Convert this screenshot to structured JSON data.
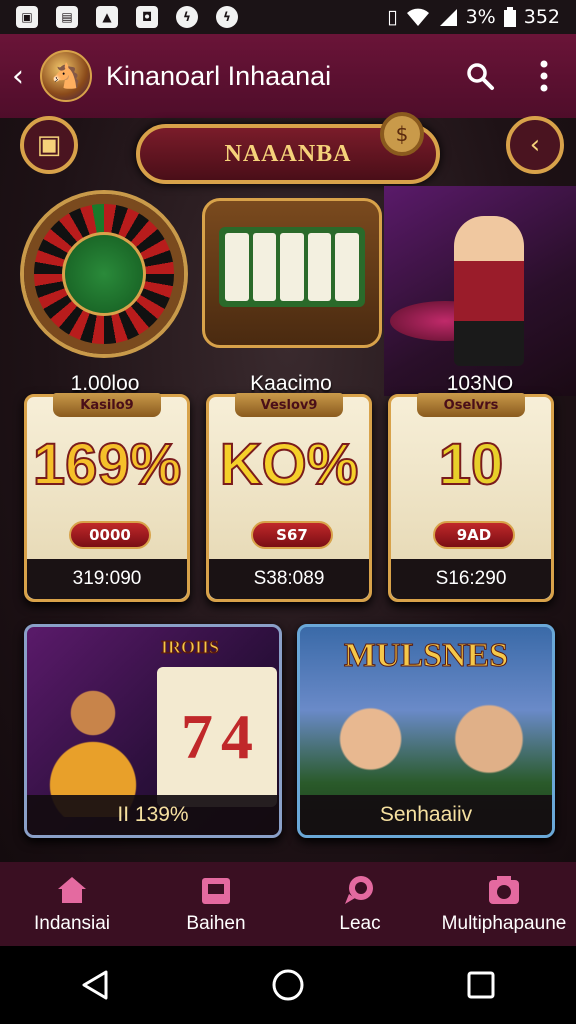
{
  "status_bar": {
    "battery": "3%",
    "time": "352",
    "icons": [
      "gallery-icon",
      "document-icon",
      "image-icon",
      "photo-icon",
      "messenger-icon",
      "messenger-icon",
      "vibrate-icon",
      "wifi-icon",
      "signal-icon",
      "battery-icon"
    ]
  },
  "app_bar": {
    "title": "Kinanoarl Inhaanai",
    "icons": [
      "back-arrow-icon",
      "app-logo",
      "search-icon",
      "more-vert-icon"
    ]
  },
  "banner": {
    "title": "NAAANBA",
    "icons": [
      "chest-icon",
      "money-bag-icon",
      "chevron-left-icon"
    ]
  },
  "top_games": [
    {
      "label": "1.00loo",
      "art": "roulette-wheel"
    },
    {
      "label": "Kaacimo",
      "art": "slot-machine"
    },
    {
      "label": "103NO",
      "art": "casino-dealer"
    }
  ],
  "slot_cards": [
    {
      "tab": "Kasilo9",
      "big": "169%",
      "pill": "0000",
      "amount": "319:090",
      "big_color": "#f5c02a"
    },
    {
      "tab": "Veslov9",
      "big": "KO%",
      "pill": "S67",
      "amount": "S38:089",
      "big_color": "#f5d02a"
    },
    {
      "tab": "Oselvrs",
      "big": "10",
      "pill": "9AD",
      "amount": "S16:290",
      "big_color": "#e8d02a"
    }
  ],
  "featured": [
    {
      "title": "IROIIS",
      "reels": [
        "7",
        "4"
      ],
      "footer": "II 139%"
    },
    {
      "title": "MULSNES",
      "footer": "Senhaaiiv"
    }
  ],
  "bottom_nav": [
    {
      "label": "Indansiai",
      "icon": "home-icon"
    },
    {
      "label": "Baihen",
      "icon": "gift-icon"
    },
    {
      "label": "Leac",
      "icon": "chat-icon"
    },
    {
      "label": "Multiphapaune",
      "icon": "camera-icon"
    }
  ],
  "system_nav": [
    "back-triangle-icon",
    "home-circle-icon",
    "recents-square-icon"
  ],
  "colors": {
    "app_bar": "#5a1030",
    "gold": "#d8a24a",
    "bottom_nav": "#3a0f22"
  }
}
